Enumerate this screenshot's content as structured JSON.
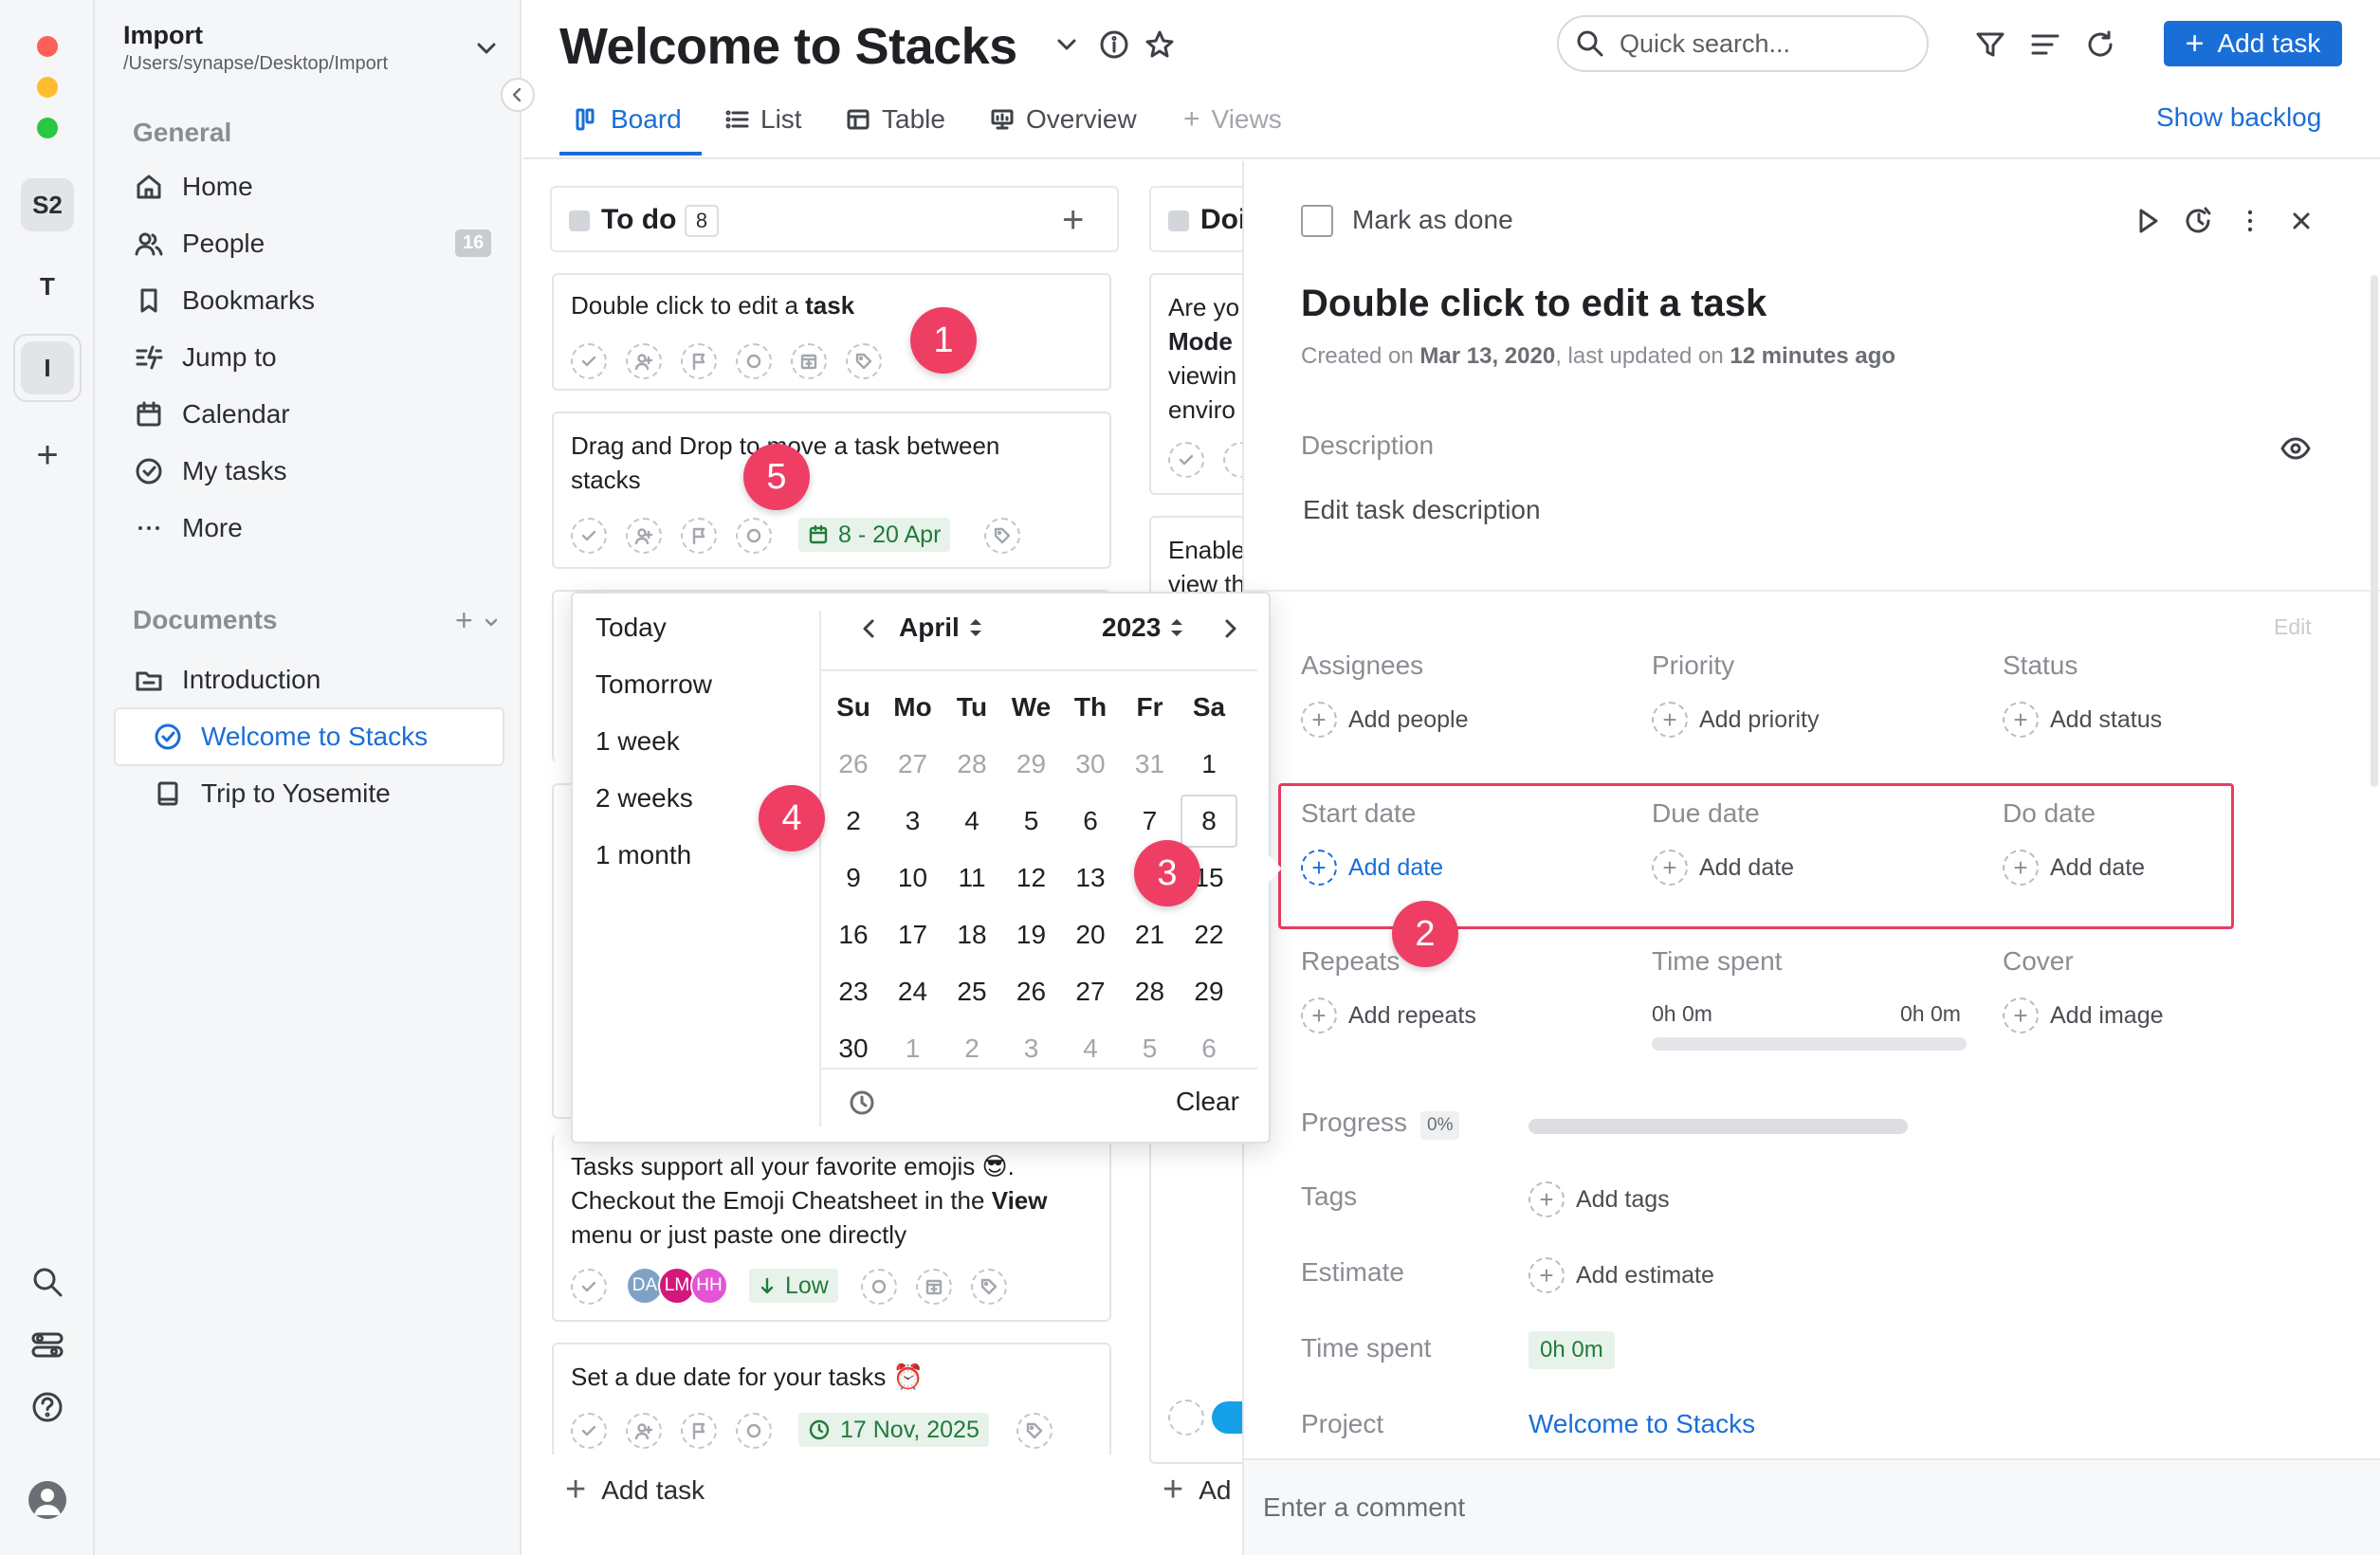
{
  "window": {
    "traffic_lights": [
      "#fe5f57",
      "#febc2e",
      "#28c840"
    ]
  },
  "rail": {
    "workspaces": [
      "S2",
      "T",
      "I"
    ],
    "add_label": "+"
  },
  "sidebar": {
    "workspace_name": "Import",
    "workspace_path": "/Users/synapse/Desktop/Import",
    "general_title": "General",
    "items": [
      {
        "label": "Home",
        "icon": "home-icon"
      },
      {
        "label": "People",
        "icon": "people-icon",
        "badge": "16"
      },
      {
        "label": "Bookmarks",
        "icon": "bookmark-icon"
      },
      {
        "label": "Jump to",
        "icon": "jump-icon"
      },
      {
        "label": "Calendar",
        "icon": "calendar-icon"
      },
      {
        "label": "My tasks",
        "icon": "check-circle-icon"
      },
      {
        "label": "More",
        "icon": "more-icon"
      }
    ],
    "documents_title": "Documents",
    "documents": [
      {
        "label": "Introduction",
        "icon": "folder-icon"
      },
      {
        "label": "Welcome to Stacks",
        "icon": "check-circle-icon",
        "active": true
      },
      {
        "label": "Trip to Yosemite",
        "icon": "book-icon"
      }
    ]
  },
  "header": {
    "title": "Welcome to Stacks",
    "search_placeholder": "Quick search...",
    "add_task_label": "Add task",
    "show_backlog": "Show backlog",
    "tabs": [
      "Board",
      "List",
      "Table",
      "Overview",
      "Views"
    ],
    "active_tab": "Board",
    "accent": "#1a6ed8"
  },
  "board": {
    "todo": {
      "title": "To do",
      "count": "8"
    },
    "doing": {
      "title": "Doi"
    },
    "cards": {
      "c1": {
        "text": "Double click to edit a ",
        "bold": "task"
      },
      "c2": {
        "line1": "Drag and Drop to move a task between",
        "line2": "stacks",
        "date": "8 - 20 Apr"
      },
      "c3": {
        "line1": "Tasks support all your favorite emojis 😎.",
        "line2a": "Checkout the Emoji Cheatsheet in the ",
        "line2b": "View",
        "line3": "menu or just paste one directly",
        "avatars": [
          "DA",
          "LM",
          "HH"
        ],
        "priority": "Low"
      },
      "c4": {
        "text": "Set a due date for your tasks ⏰",
        "date": "17 Nov, 2025"
      }
    },
    "doing_cards": {
      "d1": [
        "Are yo",
        "Mode",
        "viewin",
        "enviro"
      ],
      "d2": [
        "Enable",
        "view th"
      ]
    },
    "add_task": "Add task",
    "add_short": "Ad"
  },
  "datepicker": {
    "presets": [
      "Today",
      "Tomorrow",
      "1 week",
      "2 weeks",
      "1 month"
    ],
    "month": "April",
    "year": "2023",
    "weekdays": [
      "Su",
      "Mo",
      "Tu",
      "We",
      "Th",
      "Fr",
      "Sa"
    ],
    "weeks": [
      [
        "26",
        "27",
        "28",
        "29",
        "30",
        "31",
        "1"
      ],
      [
        "2",
        "3",
        "4",
        "5",
        "6",
        "7",
        "8"
      ],
      [
        "9",
        "10",
        "11",
        "12",
        "13",
        "14",
        "15"
      ],
      [
        "16",
        "17",
        "18",
        "19",
        "20",
        "21",
        "22"
      ],
      [
        "23",
        "24",
        "25",
        "26",
        "27",
        "28",
        "29"
      ],
      [
        "30",
        "1",
        "2",
        "3",
        "4",
        "5",
        "6"
      ]
    ],
    "clear": "Clear"
  },
  "detail": {
    "mark_done": "Mark as done",
    "title": "Double click to edit a task",
    "created_prefix": "Created on ",
    "created_date": "Mar 13, 2020",
    "updated_prefix": ", last updated on ",
    "updated_value": "12 minutes ago",
    "description_label": "Description",
    "description_placeholder": "Edit task description",
    "edit": "Edit",
    "assignees": "Assignees",
    "add_people": "Add people",
    "priority": "Priority",
    "add_priority": "Add priority",
    "status": "Status",
    "add_status": "Add status",
    "start_date": "Start date",
    "due_date": "Due date",
    "do_date": "Do date",
    "add_date": "Add date",
    "repeats": "Repeats",
    "add_repeats": "Add repeats",
    "time_spent": "Time spent",
    "time_a": "0h 0m",
    "time_b": "0h 0m",
    "cover": "Cover",
    "add_image": "Add image",
    "progress": "Progress",
    "progress_pct": "0%",
    "progress_value": 0,
    "tags": "Tags",
    "add_tags": "Add tags",
    "estimate": "Estimate",
    "add_estimate": "Add estimate",
    "time_spent2": "Time spent",
    "time_spent2_value": "0h 0m",
    "project": "Project",
    "project_value": "Welcome to Stacks",
    "comment_placeholder": "Enter a comment"
  },
  "markers": [
    "1",
    "2",
    "3",
    "4",
    "5"
  ]
}
